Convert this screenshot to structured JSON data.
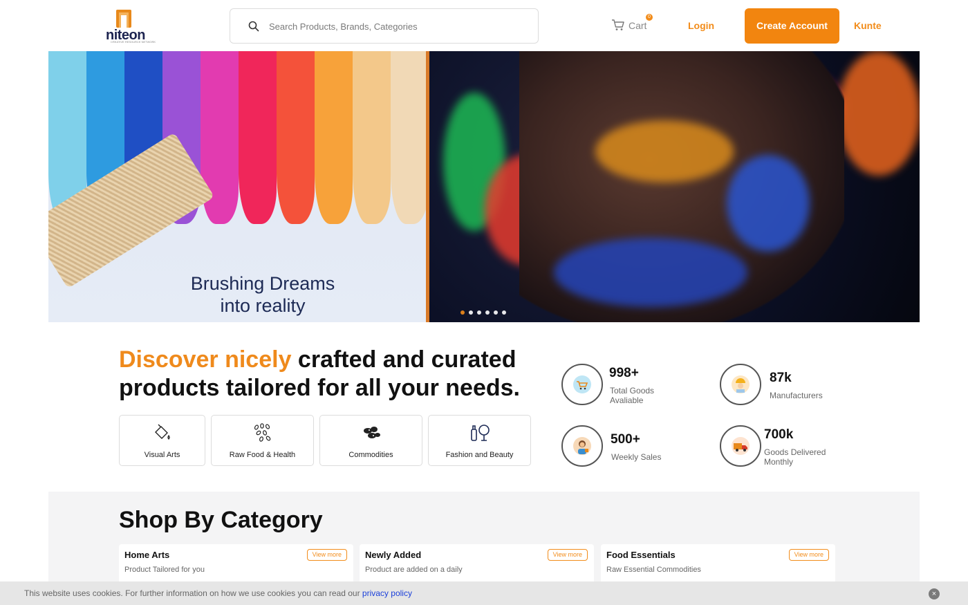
{
  "header": {
    "logo_text": "niteon",
    "logo_tagline": "CREATIVE RESOURCE NETWORK",
    "search_placeholder": "Search Products, Brands, Categories",
    "cart_label": "Cart",
    "cart_count": "0",
    "login_label": "Login",
    "create_account_label": "Create Account",
    "user_name": "Kunte"
  },
  "banner": {
    "line1": "Brushing Dreams",
    "line2": "into reality",
    "slide_count": 6,
    "active_slide": 1
  },
  "hero": {
    "headline_accent": "Discover nicely",
    "headline_rest": " crafted and curated products tailored for all your needs."
  },
  "categories": [
    {
      "label": "Visual Arts",
      "icon": "paint-bucket-icon"
    },
    {
      "label": "Raw Food & Health",
      "icon": "grains-icon"
    },
    {
      "label": "Commodities",
      "icon": "cocoa-beans-icon"
    },
    {
      "label": "Fashion and Beauty",
      "icon": "cosmetics-mirror-icon"
    }
  ],
  "stats": [
    {
      "value": "998+",
      "label": "Total Goods Avaliable",
      "icon": "shopping-cart-icon"
    },
    {
      "value": "87k",
      "label": "Manufacturers",
      "icon": "worker-icon"
    },
    {
      "value": "500+",
      "label": "Weekly Sales",
      "icon": "shopper-icon"
    },
    {
      "value": "700k",
      "label": "Goods Delivered Monthly",
      "icon": "delivery-truck-icon"
    }
  ],
  "shop": {
    "title": "Shop By Category",
    "cards": [
      {
        "title": "Home Arts",
        "subtitle": "Product Tailored for you",
        "action": "View more"
      },
      {
        "title": "Newly Added",
        "subtitle": "Product are added on a daily",
        "action": "View more"
      },
      {
        "title": "Food Essentials",
        "subtitle": "Raw Essential Commodities",
        "action": "View more"
      }
    ]
  },
  "cookie": {
    "message": "This website uses cookies. For further information on how we use cookies you can read our",
    "link_label": "privacy policy",
    "close": "×"
  },
  "colors": {
    "accent": "#f2850f",
    "link": "#1a3fd9"
  }
}
